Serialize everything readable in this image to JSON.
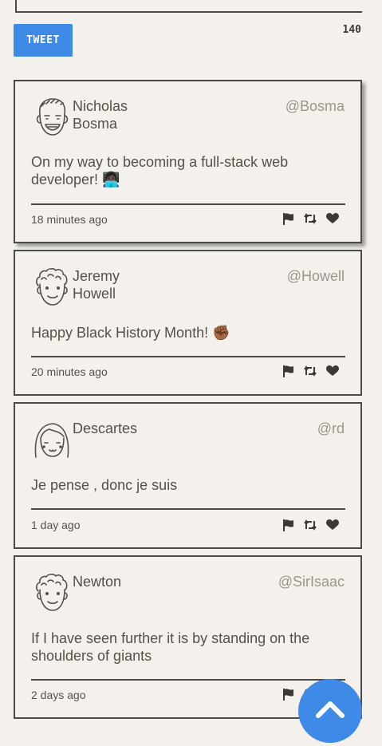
{
  "composer": {
    "tweet_button_label": "TWEET",
    "char_counter": "140"
  },
  "tweets": [
    {
      "name": "Nicholas Bosma",
      "handle": "@Bosma",
      "text": "On my way to becoming a full-stack web developer! 👩🏿‍💻",
      "time": "18 minutes ago",
      "avatar_icon": "smiling-face-avatar-icon"
    },
    {
      "name": "Jeremy Howell",
      "handle": "@Howell",
      "text": "Happy Black History Month! ✊🏾",
      "time": "20 minutes ago",
      "avatar_icon": "curly-hair-avatar-icon"
    },
    {
      "name": "Descartes",
      "handle": "@rd",
      "text": "Je pense , donc je suis",
      "time": "1 day ago",
      "avatar_icon": "bangs-hair-avatar-icon"
    },
    {
      "name": "Newton",
      "handle": "@SirIsaac",
      "text": "If I have seen further it is by standing on the shoulders of giants",
      "time": "2 days ago",
      "avatar_icon": "curly-hair-avatar-icon"
    }
  ],
  "icons": {
    "flag": "flag-icon",
    "retweet": "retweet-icon",
    "like": "heart-icon",
    "scroll_top": "chevron-up-icon"
  },
  "colors": {
    "background": "#f4f1ec",
    "accent": "#3f8ae6",
    "border": "#4a4a4a",
    "handle": "#9a968d"
  }
}
